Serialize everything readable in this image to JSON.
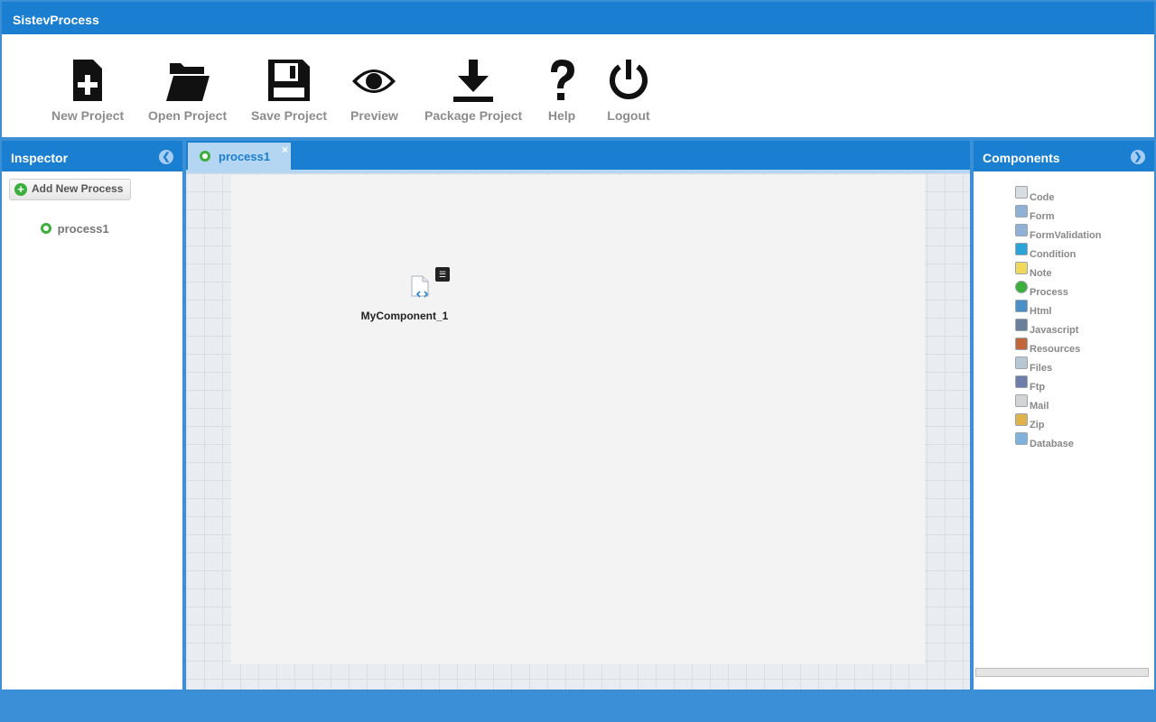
{
  "app": {
    "title": "SistevProcess"
  },
  "toolbar": {
    "new_project": "New Project",
    "open_project": "Open Project",
    "save_project": "Save Project",
    "preview": "Preview",
    "package_project": "Package Project",
    "help": "Help",
    "logout": "Logout"
  },
  "inspector": {
    "title": "Inspector",
    "add_button": "Add New Process",
    "tree": [
      "process1"
    ]
  },
  "editor": {
    "tab_label": "process1",
    "tab_close": "×",
    "node_label": "MyComponent_1"
  },
  "components": {
    "title": "Components",
    "items": [
      {
        "label": "Code",
        "icon": "code-icon"
      },
      {
        "label": "Form",
        "icon": "form-icon"
      },
      {
        "label": "FormValidation",
        "icon": "form-validation-icon"
      },
      {
        "label": "Condition",
        "icon": "condition-icon"
      },
      {
        "label": "Note",
        "icon": "note-icon"
      },
      {
        "label": "Process",
        "icon": "process-icon"
      },
      {
        "label": "Html",
        "icon": "html-icon"
      },
      {
        "label": "Javascript",
        "icon": "javascript-icon"
      },
      {
        "label": "Resources",
        "icon": "resources-icon"
      },
      {
        "label": "Files",
        "icon": "files-icon"
      },
      {
        "label": "Ftp",
        "icon": "ftp-icon"
      },
      {
        "label": "Mail",
        "icon": "mail-icon"
      },
      {
        "label": "Zip",
        "icon": "zip-icon"
      },
      {
        "label": "Database",
        "icon": "database-icon"
      }
    ]
  },
  "colors": {
    "header_blue": "#1a7fd0",
    "frame_blue": "#3a8fd6",
    "tab_blue": "#b4d6f3",
    "label_gray": "#8c8c8c"
  }
}
